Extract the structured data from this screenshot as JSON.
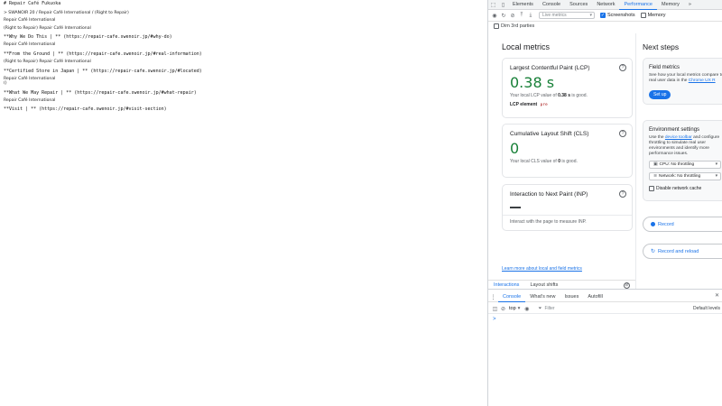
{
  "document": {
    "title": "# Repair Café Fukuoka",
    "paras": [
      "> SWANOIR 20 / Repair Café International ()",
      "",
      "Repair Café International",
      "",
      "**Why We Do This | ** (https://repair-cafe.swenoir.jp/#why-do)",
      "",
      "Repair Café International",
      "",
      "**From the Ground | ** (https://repair-cafe.swenoir.jp/#real-information)",
      "",
      "",
      "Right to Repair Repair Café International",
      "",
      "**Certified Store in Japan | ** (https://repair-cafe.swenoir.jp/#located)",
      "",
      "Repair Café International ()",
      "",
      "**What We May Repair | ** (https://repair-cafe.swenoir.jp/#what-repair)",
      "",
      "",
      "**Visit | ** (https://repair-cafe.swenoir.jp/#visit-section)"
    ],
    "headings": [
      "**Why We Do This | ** (https://repair-cafe.swenoir.jp/#why-do)",
      "**From the Ground | ** (https://repair-cafe.swenoir.jp/#real-information)",
      "**Certified Store in Japan | ** (https://repair-cafe.swenoir.jp/#located)",
      "**What We May Repair | ** (https://repair-cafe.swenoir.jp/#what-repair)",
      "**Visit | ** (https://repair-cafe.swenoir.jp/#visit-section)"
    ],
    "body_intro": "> SWANOIR 20 / Repair Café International / (Right to Repair)",
    "body_a": "Repair Café International",
    "body_b": "(Right to Repair) Repair Café International",
    "body_c": "Repair Café International",
    "body_d": "Repair Café International",
    "body_e": "()"
  },
  "devtools": {
    "tabs": [
      "Elements",
      "Console",
      "Sources",
      "Network",
      "Performance",
      "Memory"
    ],
    "active_tab": "Performance",
    "more_tabs": "»",
    "toolbar": {
      "metrics_select": "Live metrics",
      "screenshots_label": "Screenshots",
      "memory_label": "Memory",
      "dim_label": "Dim 3rd parties"
    },
    "local": {
      "title": "Local metrics",
      "lcp": {
        "title": "Largest Contentful Paint (LCP)",
        "value": "0.38 s",
        "desc_prefix": "Your local LCP value of ",
        "desc_value": "0.38 s",
        "desc_suffix": " is good.",
        "element_label": "LCP element",
        "element_tag": "pre"
      },
      "cls": {
        "title": "Cumulative Layout Shift (CLS)",
        "value": "0",
        "desc_prefix": "Your local CLS value of ",
        "desc_value": "0",
        "desc_suffix": " is good."
      },
      "inp": {
        "title": "Interaction to Next Paint (INP)",
        "desc": "Interact with the page to measure INP."
      },
      "learn_link": "Learn more about local and field metrics"
    },
    "subtabs": [
      "Interactions",
      "Layout shifts"
    ],
    "next": {
      "title": "Next steps",
      "field": {
        "title": "Field metrics",
        "desc_a": "See how your local metrics compare to real user data in the ",
        "desc_link": "Chrome UX R",
        "button": "Set up"
      },
      "env": {
        "title": "Environment settings",
        "desc_a": "Use the ",
        "desc_link": "device toolbar",
        "desc_b": " and configure throttling to simulate real user environments and identify more performance issues.",
        "cpu": "CPU: No throttling",
        "network": "Network: No throttling",
        "disable_cache": "Disable network cache"
      },
      "record": "Record",
      "record_reload": "Record and reload"
    },
    "drawer": {
      "tabs": [
        "Console",
        "What's new",
        "Issues",
        "Autofill"
      ],
      "context": "top",
      "filter_placeholder": "Filter",
      "levels": "Default levels",
      "prompt": ">"
    }
  }
}
